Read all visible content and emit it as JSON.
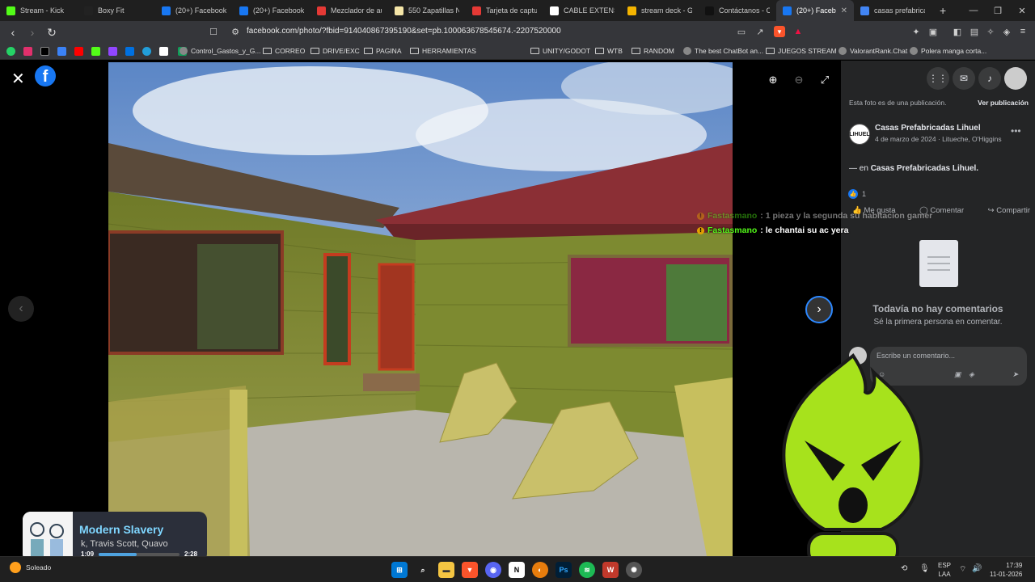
{
  "tabs": [
    {
      "title": "Stream - Kick",
      "color": "#53fc18"
    },
    {
      "title": "Boxy Fit",
      "color": "#222222"
    },
    {
      "title": "(20+) Facebook M",
      "color": "#1877f2"
    },
    {
      "title": "(20+) Facebook",
      "color": "#1877f2"
    },
    {
      "title": "Mezclador de au",
      "color": "#e53935"
    },
    {
      "title": "550 Zapatillas Ne",
      "color": "#f5e6a8"
    },
    {
      "title": "Tarjeta de captur",
      "color": "#e53935"
    },
    {
      "title": "CABLE EXTENSIO",
      "color": "#ffffff"
    },
    {
      "title": "stream deck - Go",
      "color": "#f4b400"
    },
    {
      "title": "Contáctanos - Ca",
      "color": "#111111"
    },
    {
      "title": "(20+) Facebo",
      "color": "#1877f2"
    },
    {
      "title": "casas prefabricad",
      "color": "#4285f4"
    }
  ],
  "address": {
    "url": "facebook.com/photo/?fbid=914040867395190&set=pb.100063678545674.-2207520000"
  },
  "bookmarks": [
    {
      "label": "Control_Gastos_y_G...",
      "type": "site"
    },
    {
      "label": "CORREO",
      "type": "folder"
    },
    {
      "label": "DRIVE/EXC",
      "type": "folder"
    },
    {
      "label": "PAGINA",
      "type": "folder"
    },
    {
      "label": "HERRAMIENTAS",
      "type": "folder"
    },
    {
      "label": "UNITY/GODOT",
      "type": "folder"
    },
    {
      "label": "WTB",
      "type": "folder"
    },
    {
      "label": "RANDOM",
      "type": "folder"
    },
    {
      "label": "The best ChatBot an...",
      "type": "site"
    },
    {
      "label": "JUEGOS STREAM",
      "type": "folder"
    },
    {
      "label": "ValorantRank.Chat",
      "type": "site"
    },
    {
      "label": "Polera manga corta...",
      "type": "site"
    }
  ],
  "panel": {
    "badge": "20+",
    "publication_note": "Esta foto es de una publicación.",
    "view_publication": "Ver publicación",
    "page_name": "Casas Prefabricadas Lihuel",
    "page_meta": "4 de marzo de 2024 · Litueche, O'Higgins",
    "page_avatar_text": "LIHUEL",
    "caption_prefix": "— en",
    "caption_page": "Casas Prefabricadas Lihuel.",
    "likes": "1",
    "like_label": "Me gusta",
    "comment_label": "Comentar",
    "share_label": "Compartir",
    "no_comments": "Todavía no hay comentarios",
    "first_comment": "Sé la primera persona en comentar.",
    "comment_placeholder": "Escribe un comentario..."
  },
  "chat": [
    {
      "user": "Fastasmano",
      "message": ": 1 pieza y la segunda su habitacion gamer",
      "faded": true
    },
    {
      "user": "Fastasmano",
      "message": ": le chantai su ac yera",
      "faded": false
    }
  ],
  "music": {
    "title": "Modern Slavery",
    "artist": "k, Travis Scott, Quavo",
    "current": "1:09",
    "total": "2:28",
    "progress": 0.47
  },
  "taskbar": {
    "weather": "Soleado",
    "lang1": "ESP",
    "lang2": "LAA",
    "time": "17:39",
    "date": "11-01-2026"
  }
}
